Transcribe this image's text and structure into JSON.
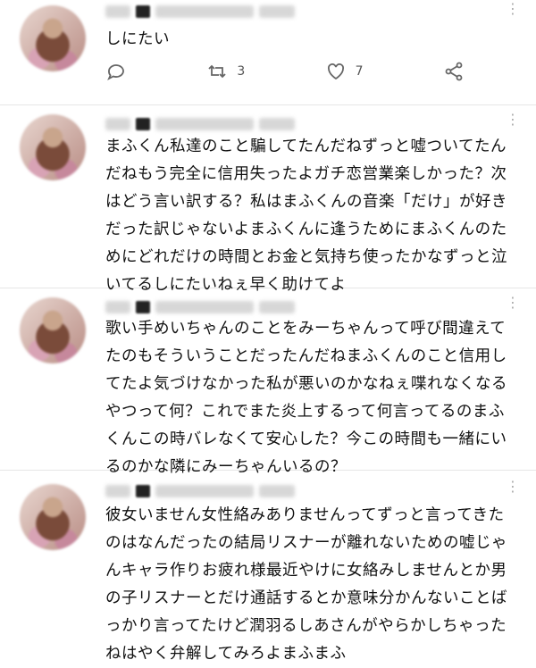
{
  "tweets": [
    {
      "text": "しにたい",
      "retweets": "3",
      "likes": "7"
    },
    {
      "text": "まふくん私達のこと騙してたんだねずっと嘘ついてたんだねもう完全に信用失ったよガチ恋営業楽しかった？次はどう言い訳する？私はまふくんの音楽「だけ」が好きだった訳じゃないよまふくんに逢うためにまふくんのためにどれだけの時間とお金と気持ち使ったかなずっと泣いてるしにたいねぇ早く助けてよ"
    },
    {
      "text": "歌い手めいちゃんのことをみーちゃんって呼び間違えてたのもそういうことだったんだねまふくんのこと信用してたよ気づけなかった私が悪いのかなねぇ喋れなくなるやつって何？これでまた炎上するって何言ってるのまふくんこの時バレなくて安心した？今この時間も一緒にいるのかな隣にみーちゃんいるの？"
    },
    {
      "text": "彼女いません女性絡みありませんってずっと言ってきたのはなんだったの結局リスナーが離れないための嘘じゃんキャラ作りお疲れ様最近やけに女絡みしませんとか男の子リスナーとだけ通話するとか意味分かんないことばっかり言ってたけど潤羽るしあさんがやらかしちゃったねはやく弁解してみろよまふまふ"
    }
  ]
}
